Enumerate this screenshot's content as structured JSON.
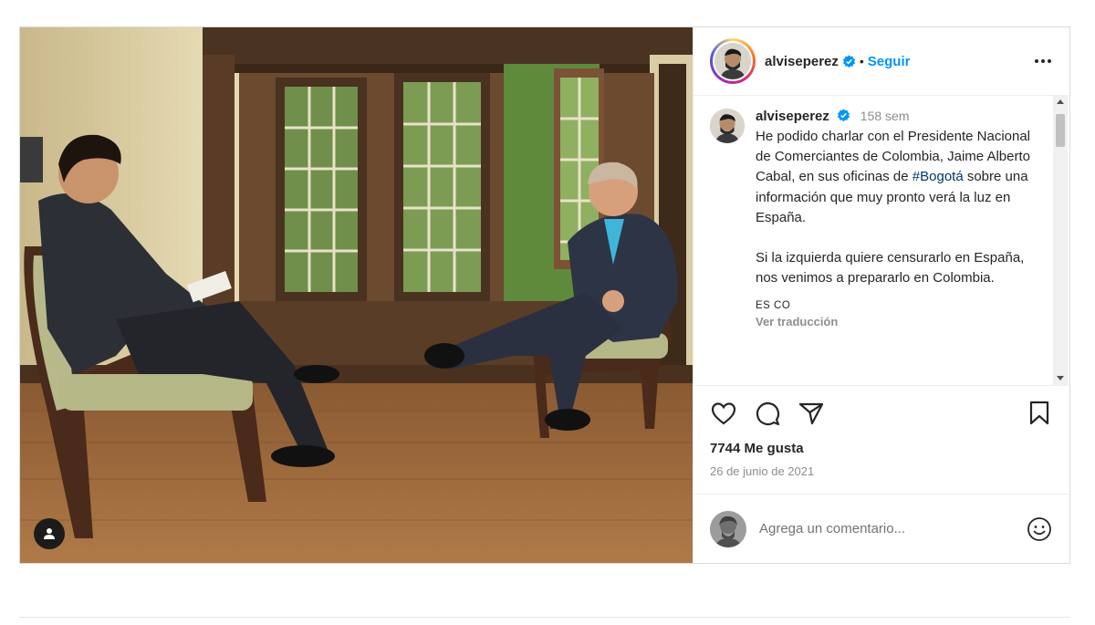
{
  "post": {
    "username": "alviseperez",
    "follow_label": "Seguir",
    "separator": "•",
    "caption": {
      "age": "158 sem",
      "body_1": "He podido charlar con el Presidente Nacional de Comerciantes de Colombia, Jaime Alberto Cabal, en sus oficinas de ",
      "hashtag": "#Bogotá",
      "body_2": " sobre una información que muy pronto verá la luz en España.\n\nSi la izquierda quiere censurarlo en España, nos venimos a prepararlo en Colombia.",
      "lang": "ES CO",
      "translate_label": "Ver traducción"
    },
    "likes": "7744 Me gusta",
    "date": "26 de junio de 2021",
    "comment_placeholder": "Agrega un comentario..."
  },
  "icons": {
    "like": "heart-icon",
    "comment": "comment-bubble-icon",
    "share": "paper-plane-icon",
    "save": "bookmark-icon",
    "more": "more-dots-icon",
    "emoji": "smiley-icon",
    "tag": "user-tag-icon",
    "verified": "verified-badge-icon"
  },
  "colors": {
    "accent": "#0095f6",
    "hashtag": "#00376b",
    "verified": "#0095f6",
    "muted": "#8e8e8e"
  }
}
